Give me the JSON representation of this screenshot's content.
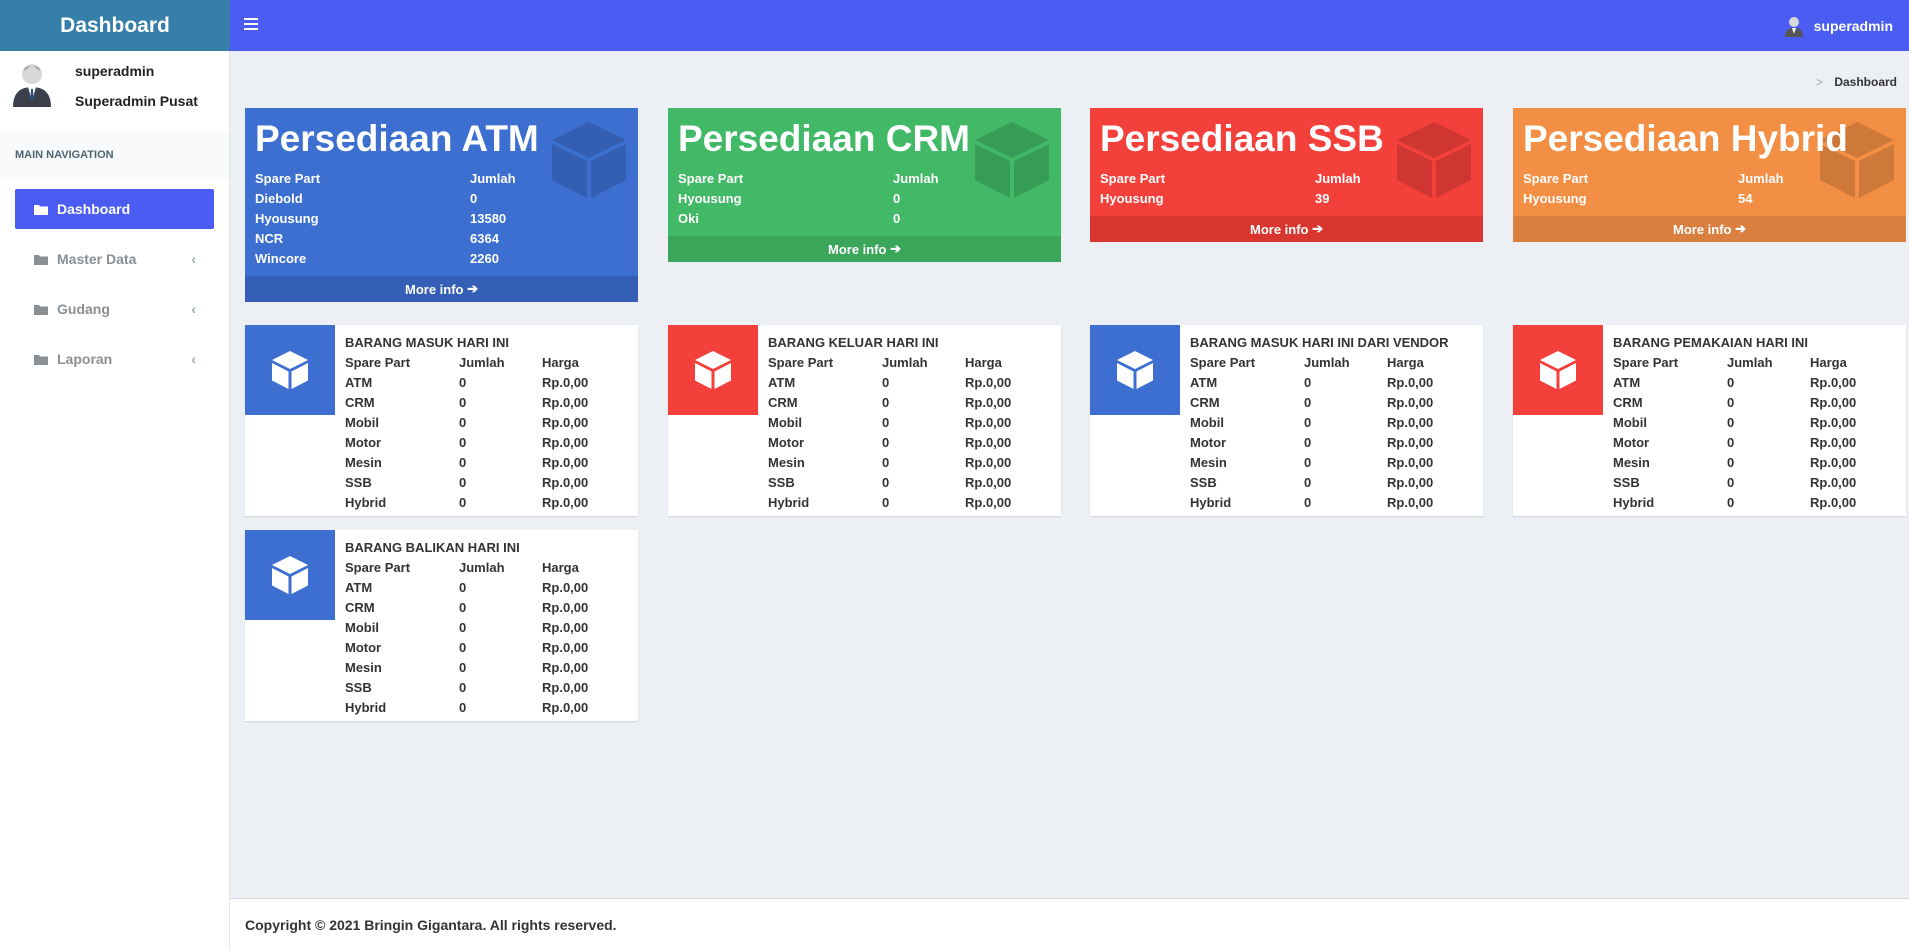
{
  "app": {
    "title": "Dashboard"
  },
  "topbar": {
    "username": "superadmin"
  },
  "sidebar": {
    "user_name": "superadmin",
    "user_role": "Superadmin Pusat",
    "nav_header": "MAIN NAVIGATION",
    "items": [
      {
        "label": "Dashboard",
        "active": true
      },
      {
        "label": "Master Data",
        "active": false
      },
      {
        "label": "Gudang",
        "active": false
      },
      {
        "label": "Laporan",
        "active": false
      }
    ]
  },
  "breadcrumb": {
    "current": "Dashboard"
  },
  "stock_boxes": [
    {
      "title": "Persediaan ATM",
      "color": "#3c6fd0",
      "header": [
        "Spare Part",
        "Jumlah"
      ],
      "rows": [
        [
          "Diebold",
          "0"
        ],
        [
          "Hyousung",
          "13580"
        ],
        [
          "NCR",
          "6364"
        ],
        [
          "Wincore",
          "2260"
        ]
      ],
      "more": "More info"
    },
    {
      "title": "Persediaan CRM",
      "color": "#41b966",
      "header": [
        "Spare Part",
        "Jumlah"
      ],
      "rows": [
        [
          "Hyousung",
          "0"
        ],
        [
          "Oki",
          "0"
        ]
      ],
      "more": "More info"
    },
    {
      "title": "Persediaan SSB",
      "color": "#f4403a",
      "header": [
        "Spare Part",
        "Jumlah"
      ],
      "rows": [
        [
          "Hyousung",
          "39"
        ]
      ],
      "more": "More info"
    },
    {
      "title": "Persediaan Hybrid",
      "color": "#f28f44",
      "header": [
        "Spare Part",
        "Jumlah"
      ],
      "rows": [
        [
          "Hyousung",
          "54"
        ]
      ],
      "more": "More info"
    }
  ],
  "info_boxes": [
    {
      "title": "BARANG MASUK HARI INI",
      "icon_color": "#3c6fd0"
    },
    {
      "title": "BARANG KELUAR HARI INI",
      "icon_color": "#f4403a"
    },
    {
      "title": "BARANG MASUK HARI INI DARI VENDOR",
      "icon_color": "#3c6fd0"
    },
    {
      "title": "BARANG PEMAKAIAN HARI INI",
      "icon_color": "#f4403a"
    },
    {
      "title": "BARANG BALIKAN HARI INI",
      "icon_color": "#3c6fd0"
    }
  ],
  "info_table": {
    "header": [
      "Spare Part",
      "Jumlah",
      "Harga"
    ],
    "rows": [
      [
        "ATM",
        "0",
        "Rp.0,00"
      ],
      [
        "CRM",
        "0",
        "Rp.0,00"
      ],
      [
        "Mobil",
        "0",
        "Rp.0,00"
      ],
      [
        "Motor",
        "0",
        "Rp.0,00"
      ],
      [
        "Mesin",
        "0",
        "Rp.0,00"
      ],
      [
        "SSB",
        "0",
        "Rp.0,00"
      ],
      [
        "Hybrid",
        "0",
        "Rp.0,00"
      ]
    ]
  },
  "footer": {
    "text": "Copyright © 2021 Bringin Gigantara. All rights reserved."
  }
}
